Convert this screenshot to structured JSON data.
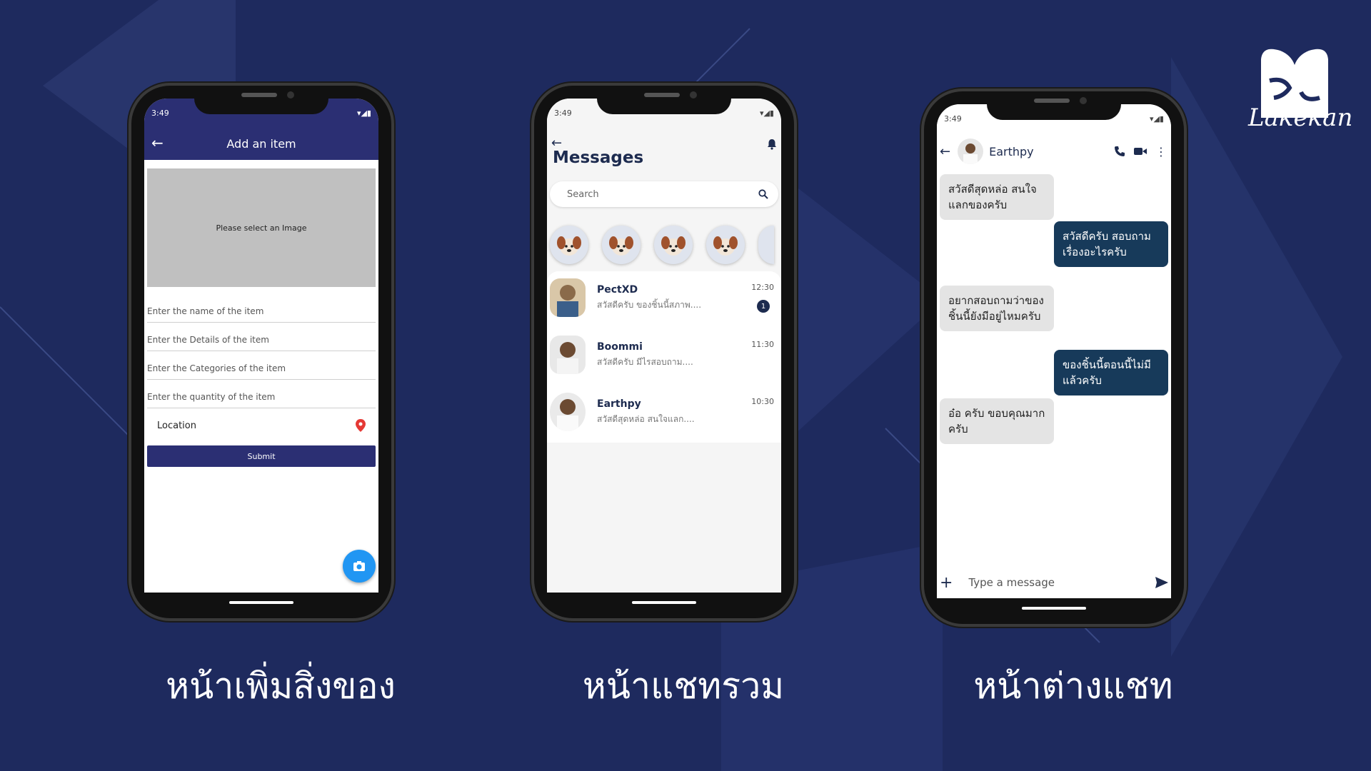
{
  "brand": {
    "name": "Lakekan"
  },
  "phones": [
    {
      "status_time": "3:49",
      "caption": "หน้าเพิ่มสิ่งของ",
      "appbar_title": "Add an item",
      "image_placeholder": "Please select an Image",
      "fields": [
        "Enter the name of the item",
        "Enter the Details of the item",
        "Enter the Categories of the item",
        "Enter the quantity of the item"
      ],
      "location_label": "Location",
      "submit_label": "Submit"
    },
    {
      "status_time": "3:49",
      "caption": "หน้าแชทรวม",
      "title": "Messages",
      "search_placeholder": "Search",
      "chats": [
        {
          "name": "PectXD",
          "preview": "สวัสดีครับ ของชิ้นนี้สภาพ....",
          "time": "12:30",
          "unread": "1"
        },
        {
          "name": "Boommi",
          "preview": "สวัสดีครับ มีไรสอบถาม....",
          "time": "11:30"
        },
        {
          "name": "Earthpy",
          "preview": "สวัสดีสุดหล่อ สนใจแลก....",
          "time": "10:30"
        }
      ]
    },
    {
      "status_time": "3:49",
      "caption": "หน้าต่างแชท",
      "contact_name": "Earthpy",
      "messages": [
        {
          "from": "in",
          "text": "สวัสดีสุดหล่อ สนใจแลกของครับ"
        },
        {
          "from": "out",
          "text": "สวัสดีครับ สอบถามเรื่องอะไรครับ"
        },
        {
          "from": "in",
          "text": "อยากสอบถามว่าของชิ้นนี้ยังมีอยู่ไหมครับ"
        },
        {
          "from": "out",
          "text": "ของชิ้นนี้ตอนนี้ไม่มีแล้วครับ"
        },
        {
          "from": "in",
          "text": "อ๋อ ครับ ขอบคุณมากครับ"
        }
      ],
      "composer_placeholder": "Type a message"
    }
  ],
  "colors": {
    "background": "#1e2a5e",
    "appbar": "#2b2f73",
    "fab": "#2196f3",
    "bubble_out": "#173a5a"
  }
}
